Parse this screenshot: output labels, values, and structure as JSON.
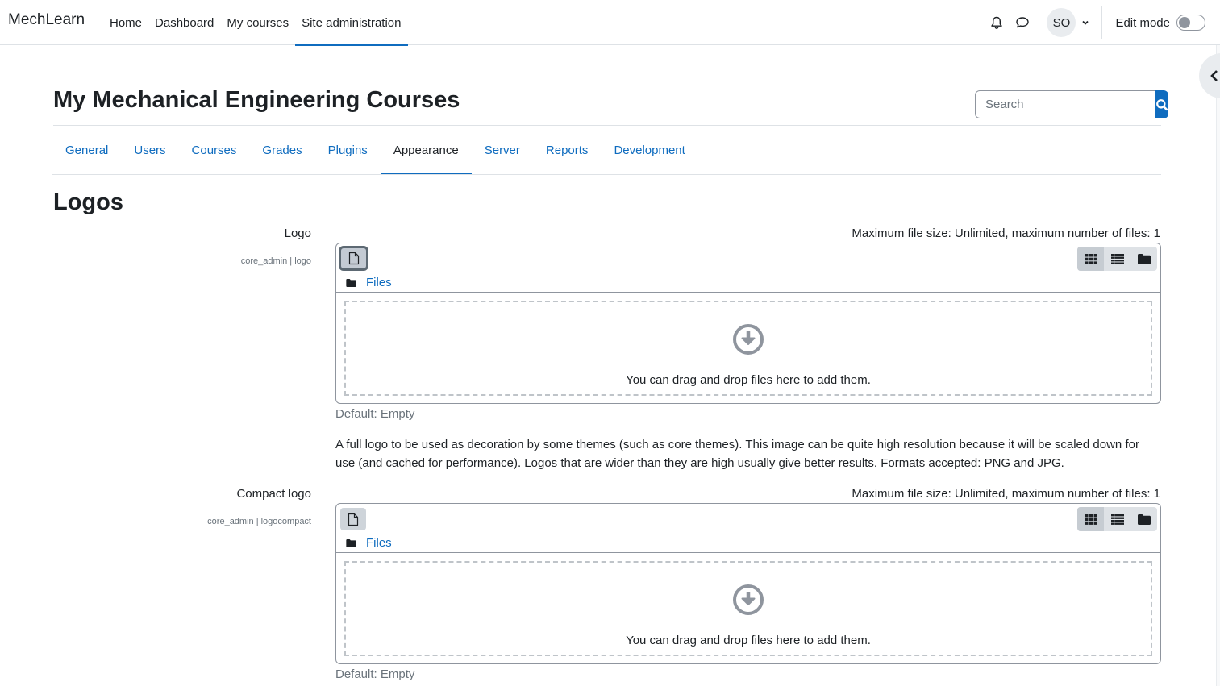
{
  "navbar": {
    "brand": "MechLearn",
    "items": [
      {
        "label": "Home",
        "active": false
      },
      {
        "label": "Dashboard",
        "active": false
      },
      {
        "label": "My courses",
        "active": false
      },
      {
        "label": "Site administration",
        "active": true
      }
    ],
    "user_initials": "SO",
    "edit_mode_label": "Edit mode",
    "edit_mode_on": false
  },
  "header": {
    "title": "My Mechanical Engineering Courses",
    "search_placeholder": "Search",
    "search_value": ""
  },
  "tabs": [
    {
      "label": "General",
      "active": false
    },
    {
      "label": "Users",
      "active": false
    },
    {
      "label": "Courses",
      "active": false
    },
    {
      "label": "Grades",
      "active": false
    },
    {
      "label": "Plugins",
      "active": false
    },
    {
      "label": "Appearance",
      "active": true
    },
    {
      "label": "Server",
      "active": false
    },
    {
      "label": "Reports",
      "active": false
    },
    {
      "label": "Development",
      "active": false
    }
  ],
  "section": {
    "title": "Logos"
  },
  "settings": [
    {
      "label": "Logo",
      "key": "core_admin | logo",
      "max_info": "Maximum file size: Unlimited, maximum number of files: 1",
      "path_label": "Files",
      "drop_text": "You can drag and drop files here to add them.",
      "default": "Default: Empty",
      "description": "A full logo to be used as decoration by some themes (such as core themes). This image can be quite high resolution because it will be scaled down for use (and cached for performance). Logos that are wider than they are high usually give better results. Formats accepted: PNG and JPG."
    },
    {
      "label": "Compact logo",
      "key": "core_admin | logocompact",
      "max_info": "Maximum file size: Unlimited, maximum number of files: 1",
      "path_label": "Files",
      "drop_text": "You can drag and drop files here to add them.",
      "default": "Default: Empty"
    }
  ],
  "icons": {
    "notifications": "bell-icon",
    "messages": "chat-bubble-icon",
    "user_menu": "chevron-down-icon",
    "drawer": "chevron-left-icon",
    "search": "search-icon",
    "add_file": "file-icon",
    "view_icons": "grid-icon",
    "view_list": "list-icon",
    "view_tree": "folder-icon",
    "upload": "download-circle-icon"
  },
  "colors": {
    "accent": "#0f6cbf",
    "text": "#1d2125",
    "muted": "#6a737b"
  }
}
